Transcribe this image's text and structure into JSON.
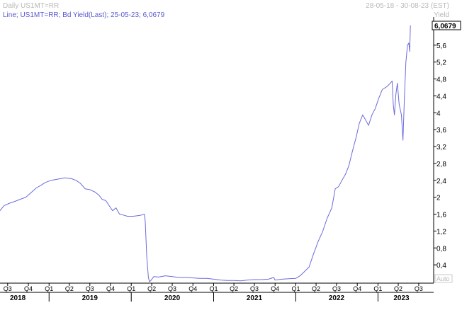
{
  "header": {
    "title": "Daily US1MT=RR",
    "date_range": "28-05-18 - 30-08-23 (EST)"
  },
  "legend": {
    "text": "Line; US1MT=RR; Bd Yield(Last); 25-05-23; 6,0679"
  },
  "y_axis": {
    "unit_label": "Yield",
    "last_value_label": "6,0679",
    "auto_label": "Auto"
  },
  "colors": {
    "series": "#6b6bdc",
    "grid_line": "#000000",
    "axis_text": "#000000",
    "header_text": "#b8b8b8",
    "legend_text": "#5a5ad0",
    "value_badge_bg": "#ffffff",
    "value_badge_border": "#000000"
  },
  "chart_data": {
    "type": "line",
    "title": "Daily US1MT=RR",
    "xlabel": "",
    "ylabel": "Yield",
    "x_range": [
      "2018-05-28",
      "2023-08-30"
    ],
    "ylim": [
      0,
      6.2
    ],
    "y_ticks": [
      "0,4",
      "0,8",
      "1,2",
      "1,6",
      "2",
      "2,4",
      "2,8",
      "3,2",
      "3,6",
      "4",
      "4,4",
      "4,8",
      "5,2",
      "5,6"
    ],
    "y_tick_values": [
      0.4,
      0.8,
      1.2,
      1.6,
      2.0,
      2.4,
      2.8,
      3.2,
      3.6,
      4.0,
      4.4,
      4.8,
      5.2,
      5.6
    ],
    "quarter_ticks": [
      {
        "label": "Q3",
        "date": "2018-07-01"
      },
      {
        "label": "Q4",
        "date": "2018-10-01"
      },
      {
        "label": "Q1",
        "date": "2019-01-01"
      },
      {
        "label": "Q2",
        "date": "2019-04-01"
      },
      {
        "label": "Q3",
        "date": "2019-07-01"
      },
      {
        "label": "Q4",
        "date": "2019-10-01"
      },
      {
        "label": "Q1",
        "date": "2020-01-01"
      },
      {
        "label": "Q2",
        "date": "2020-04-01"
      },
      {
        "label": "Q3",
        "date": "2020-07-01"
      },
      {
        "label": "Q4",
        "date": "2020-10-01"
      },
      {
        "label": "Q1",
        "date": "2021-01-01"
      },
      {
        "label": "Q2",
        "date": "2021-04-01"
      },
      {
        "label": "Q3",
        "date": "2021-07-01"
      },
      {
        "label": "Q4",
        "date": "2021-10-01"
      },
      {
        "label": "Q1",
        "date": "2022-01-01"
      },
      {
        "label": "Q2",
        "date": "2022-04-01"
      },
      {
        "label": "Q3",
        "date": "2022-07-01"
      },
      {
        "label": "Q4",
        "date": "2022-10-01"
      },
      {
        "label": "Q1",
        "date": "2023-01-01"
      },
      {
        "label": "Q2",
        "date": "2023-04-01"
      },
      {
        "label": "Q3",
        "date": "2023-07-01"
      }
    ],
    "year_labels": [
      {
        "label": "2018",
        "date": "2018-08-15"
      },
      {
        "label": "2019",
        "date": "2019-07-01"
      },
      {
        "label": "2020",
        "date": "2020-07-01"
      },
      {
        "label": "2021",
        "date": "2021-07-01"
      },
      {
        "label": "2022",
        "date": "2022-07-01"
      },
      {
        "label": "2023",
        "date": "2023-04-15"
      }
    ],
    "year_boundaries": [
      "2019-01-01",
      "2020-01-01",
      "2021-01-01",
      "2022-01-01",
      "2023-01-01"
    ],
    "last_value": 6.0679,
    "series": [
      {
        "name": "US1MT=RR",
        "points": [
          [
            "2018-05-28",
            1.68
          ],
          [
            "2018-06-15",
            1.8
          ],
          [
            "2018-07-10",
            1.86
          ],
          [
            "2018-08-01",
            1.9
          ],
          [
            "2018-08-25",
            1.95
          ],
          [
            "2018-09-20",
            2.0
          ],
          [
            "2018-10-15",
            2.12
          ],
          [
            "2018-11-05",
            2.22
          ],
          [
            "2018-11-25",
            2.28
          ],
          [
            "2018-12-15",
            2.35
          ],
          [
            "2019-01-10",
            2.4
          ],
          [
            "2019-02-10",
            2.43
          ],
          [
            "2019-03-10",
            2.46
          ],
          [
            "2019-04-10",
            2.44
          ],
          [
            "2019-05-01",
            2.4
          ],
          [
            "2019-05-20",
            2.33
          ],
          [
            "2019-06-10",
            2.2
          ],
          [
            "2019-07-01",
            2.18
          ],
          [
            "2019-07-25",
            2.12
          ],
          [
            "2019-08-10",
            2.05
          ],
          [
            "2019-08-25",
            1.95
          ],
          [
            "2019-09-10",
            1.92
          ],
          [
            "2019-09-25",
            1.8
          ],
          [
            "2019-10-10",
            1.68
          ],
          [
            "2019-10-25",
            1.75
          ],
          [
            "2019-11-10",
            1.6
          ],
          [
            "2019-11-25",
            1.58
          ],
          [
            "2019-12-15",
            1.55
          ],
          [
            "2020-01-10",
            1.55
          ],
          [
            "2020-02-10",
            1.57
          ],
          [
            "2020-02-28",
            1.6
          ],
          [
            "2020-03-03",
            1.45
          ],
          [
            "2020-03-10",
            0.6
          ],
          [
            "2020-03-17",
            0.1
          ],
          [
            "2020-03-22",
            0.0
          ],
          [
            "2020-03-28",
            0.03
          ],
          [
            "2020-04-10",
            0.12
          ],
          [
            "2020-05-01",
            0.11
          ],
          [
            "2020-06-01",
            0.14
          ],
          [
            "2020-07-01",
            0.12
          ],
          [
            "2020-08-01",
            0.1
          ],
          [
            "2020-09-01",
            0.1
          ],
          [
            "2020-10-01",
            0.09
          ],
          [
            "2020-11-01",
            0.08
          ],
          [
            "2020-12-01",
            0.08
          ],
          [
            "2021-01-01",
            0.06
          ],
          [
            "2021-02-01",
            0.04
          ],
          [
            "2021-03-01",
            0.03
          ],
          [
            "2021-04-01",
            0.03
          ],
          [
            "2021-05-01",
            0.02
          ],
          [
            "2021-06-01",
            0.04
          ],
          [
            "2021-07-01",
            0.05
          ],
          [
            "2021-08-01",
            0.05
          ],
          [
            "2021-09-01",
            0.06
          ],
          [
            "2021-09-25",
            0.1
          ],
          [
            "2021-10-01",
            0.04
          ],
          [
            "2021-11-01",
            0.06
          ],
          [
            "2021-12-01",
            0.07
          ],
          [
            "2022-01-01",
            0.08
          ],
          [
            "2022-01-20",
            0.14
          ],
          [
            "2022-02-10",
            0.25
          ],
          [
            "2022-03-01",
            0.35
          ],
          [
            "2022-03-20",
            0.65
          ],
          [
            "2022-04-10",
            0.95
          ],
          [
            "2022-05-01",
            1.2
          ],
          [
            "2022-05-20",
            1.5
          ],
          [
            "2022-06-10",
            1.75
          ],
          [
            "2022-06-25",
            2.2
          ],
          [
            "2022-07-10",
            2.25
          ],
          [
            "2022-07-25",
            2.4
          ],
          [
            "2022-08-10",
            2.55
          ],
          [
            "2022-08-25",
            2.75
          ],
          [
            "2022-09-10",
            3.1
          ],
          [
            "2022-09-25",
            3.4
          ],
          [
            "2022-10-10",
            3.75
          ],
          [
            "2022-10-25",
            3.95
          ],
          [
            "2022-11-05",
            3.85
          ],
          [
            "2022-11-20",
            3.7
          ],
          [
            "2022-12-05",
            3.95
          ],
          [
            "2022-12-20",
            4.1
          ],
          [
            "2023-01-05",
            4.35
          ],
          [
            "2023-01-20",
            4.55
          ],
          [
            "2023-02-10",
            4.62
          ],
          [
            "2023-02-25",
            4.7
          ],
          [
            "2023-03-05",
            4.75
          ],
          [
            "2023-03-10",
            4.2
          ],
          [
            "2023-03-15",
            3.95
          ],
          [
            "2023-03-22",
            4.45
          ],
          [
            "2023-03-28",
            4.7
          ],
          [
            "2023-04-05",
            4.2
          ],
          [
            "2023-04-15",
            3.95
          ],
          [
            "2023-04-22",
            3.35
          ],
          [
            "2023-04-28",
            4.3
          ],
          [
            "2023-05-05",
            5.2
          ],
          [
            "2023-05-12",
            5.6
          ],
          [
            "2023-05-18",
            5.65
          ],
          [
            "2023-05-22",
            5.45
          ],
          [
            "2023-05-25",
            6.07
          ]
        ]
      }
    ]
  }
}
